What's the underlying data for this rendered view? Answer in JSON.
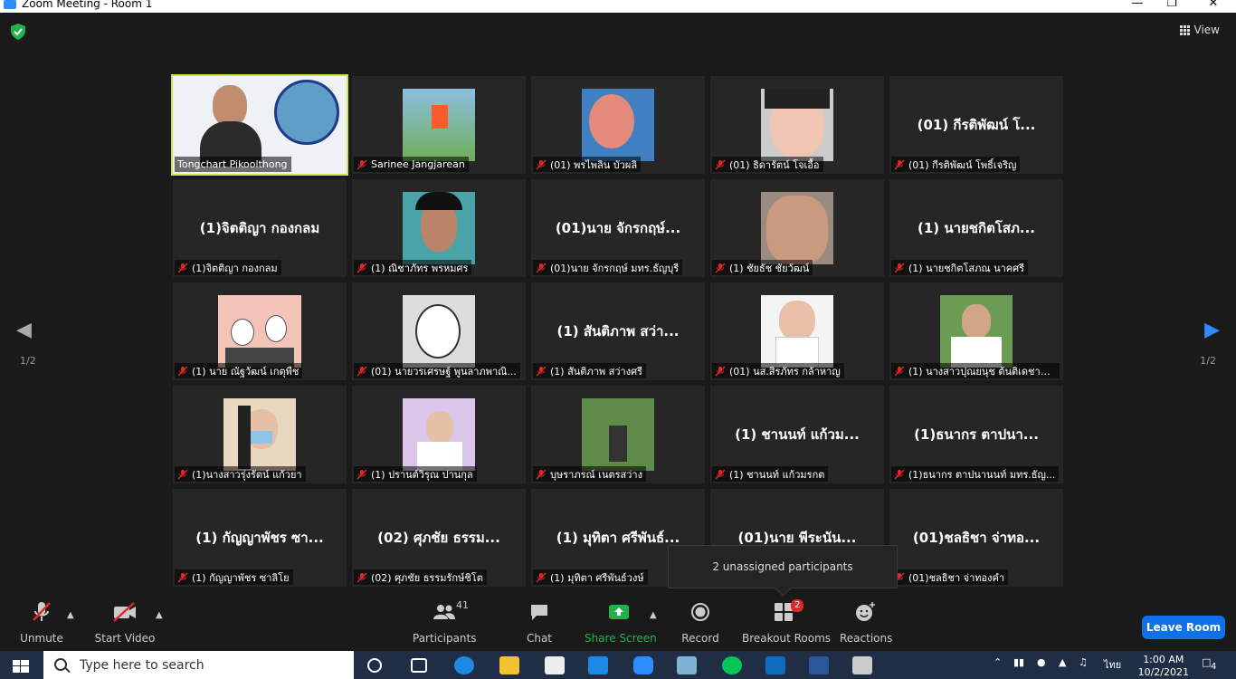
{
  "window": {
    "title": "Zoom Meeting - Room 1"
  },
  "view_label": "View",
  "pagination": {
    "left": "1/2",
    "right": "1/2"
  },
  "tiles": [
    {
      "label": "Tongchart Pikoolthong",
      "big": "",
      "kind": "video-presenter",
      "muted": false,
      "active": true
    },
    {
      "label": "Sarinee Jangjarean",
      "big": "",
      "kind": "video-outdoor",
      "muted": true
    },
    {
      "label": "(01) พรไพลิน บัวผลิ",
      "big": "",
      "kind": "video-blue",
      "muted": true
    },
    {
      "label": "(01) ธิดารัตน์ โจเอื้อ",
      "big": "",
      "kind": "video-face",
      "muted": true
    },
    {
      "label": "(01) กีรติพัฒน์ โพธิ์เจริญ",
      "big": "(01) กีรติพัฒน์ โ...",
      "kind": "name",
      "muted": true
    },
    {
      "label": "(1)จิตติญา กองกลม",
      "big": "(1)จิตติญา กองกลม",
      "kind": "name",
      "muted": true
    },
    {
      "label": "(1) ณิชาภัทร พรหมศร",
      "big": "",
      "kind": "video-face2",
      "muted": true
    },
    {
      "label": "(01)นาย จักรกฤษ์ มทร.ธัญบุรี",
      "big": "(01)นาย จักรกฤษ์...",
      "kind": "name",
      "muted": true
    },
    {
      "label": "(1) ชัยธัช ชัยวัฒน์",
      "big": "",
      "kind": "video-face3",
      "muted": true
    },
    {
      "label": "(1) นายชกิตโสภณ นาคศรี",
      "big": "(1) นายชกิตโสภ...",
      "kind": "name",
      "muted": true
    },
    {
      "label": "(1) นาย ณัฐวัฒน์ เกตุพืช",
      "big": "",
      "kind": "video-cartoon",
      "muted": true
    },
    {
      "label": "(01) นายวรเศรษฐ์ พูนลาภพาณิ...",
      "big": "",
      "kind": "video-sketch",
      "muted": true
    },
    {
      "label": "(1) สันติภาพ สว่างศรี",
      "big": "(1) สันติภาพ สว่า...",
      "kind": "name",
      "muted": true
    },
    {
      "label": "(01) นส.สิรภัทร กล้าหาญ",
      "big": "",
      "kind": "video-girl",
      "muted": true
    },
    {
      "label": "(1) นางสาวปุณยนุช ต้นติเดชาม...",
      "big": "",
      "kind": "video-student",
      "muted": true
    },
    {
      "label": "(1)นางสาวรุ่งรัตน์ แก้วยา",
      "big": "",
      "kind": "video-mask",
      "muted": true
    },
    {
      "label": "(1) ปรานต์วิรุณ ปานกุล",
      "big": "",
      "kind": "video-room",
      "muted": true
    },
    {
      "label": "บุษราภรณ์ เนตรสว่าง",
      "big": "",
      "kind": "video-park",
      "muted": true
    },
    {
      "label": "(1) ชานนท์ แก้วมรกต",
      "big": "(1) ชานนท์ แก้วม...",
      "kind": "name",
      "muted": true
    },
    {
      "label": "(1)ธนากร ตาปนานนท์ มทร.ธัญ...",
      "big": "(1)ธนากร ตาปนา...",
      "kind": "name",
      "muted": true
    },
    {
      "label": "(1) กัญญาพัชร ซาลิโย",
      "big": "(1) กัญญาพัชร ซา...",
      "kind": "name",
      "muted": true
    },
    {
      "label": "(02) ศุภชัย ธรรมรักษ์ชิโต",
      "big": "(02) ศุภชัย ธรรม...",
      "kind": "name",
      "muted": true
    },
    {
      "label": "(1) มุทิตา ศรีพันธ์วงษ์",
      "big": "(1) มุทิตา ศรีพันธ์...",
      "kind": "name",
      "muted": true
    },
    {
      "label": "(01)นาย พีระนันท์",
      "big": "(01)นาย พีระนัน...",
      "kind": "name",
      "muted": true
    },
    {
      "label": "(01)ชลธิชา จ่าทองคำ",
      "big": "(01)ชลธิชา จ่าทอ...",
      "kind": "name",
      "muted": true
    }
  ],
  "tooltip": "2 unassigned participants",
  "toolbar": {
    "unmute": "Unmute",
    "start_video": "Start Video",
    "participants": "Participants",
    "participants_count": "41",
    "chat": "Chat",
    "share_screen": "Share Screen",
    "record": "Record",
    "breakout_rooms": "Breakout Rooms",
    "breakout_badge": "2",
    "reactions": "Reactions",
    "leave_room": "Leave Room"
  },
  "taskbar": {
    "search_placeholder": "Type here to search",
    "lang": "ไทย",
    "time": "1:00 AM",
    "date": "10/2/2021",
    "notifications": "4"
  },
  "colors": {
    "active_border": "#c6e34a",
    "leave_button": "#0e71eb",
    "share_green": "#22b14c",
    "muted_red": "#e02828"
  }
}
